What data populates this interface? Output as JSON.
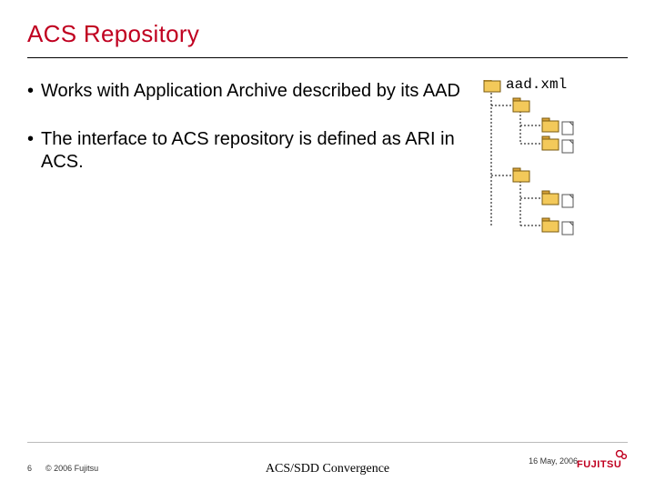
{
  "title": "ACS Repository",
  "bullets": [
    "Works with Application Archive described by its AAD",
    "The interface to ACS repository is defined as ARI in ACS."
  ],
  "tree_label": "aad.xml",
  "footer": {
    "page": "6",
    "copyright": "© 2006 Fujitsu",
    "center": "ACS/SDD Convergence",
    "date": "16 May, 2006",
    "logo_text": "FUJITSU"
  },
  "colors": {
    "title": "#c00020",
    "logo": "#c00020"
  }
}
